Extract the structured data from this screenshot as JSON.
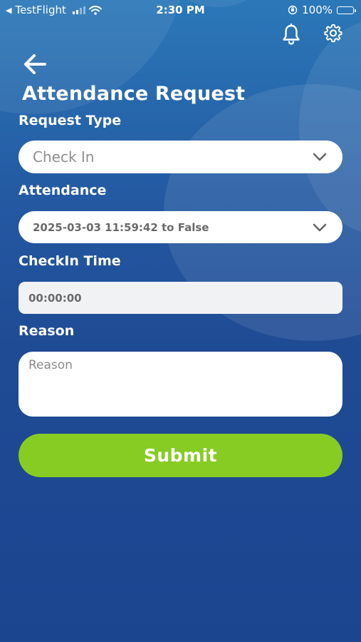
{
  "status_bar": {
    "back_app": "TestFlight",
    "time": "2:30 PM",
    "battery": "100%"
  },
  "header": {
    "notification_icon": "bell-icon",
    "settings_icon": "gear-icon",
    "back_icon": "arrow-left-icon"
  },
  "page": {
    "title": "Attendance Request"
  },
  "form": {
    "request_type": {
      "label": "Request Type",
      "value": "Check In",
      "icon": "chevron-down-icon"
    },
    "attendance": {
      "label": "Attendance",
      "value": "2025-03-03 11:59:42 to False",
      "icon": "chevron-down-icon"
    },
    "checkin_time": {
      "label": "CheckIn Time",
      "value": "00:00:00"
    },
    "reason": {
      "label": "Reason",
      "placeholder": "Reason"
    },
    "submit_label": "Submit"
  },
  "colors": {
    "background_top": "#2b78b8",
    "background_bottom": "#1c4590",
    "submit_button": "#86cc22",
    "field_background": "#ffffff"
  }
}
